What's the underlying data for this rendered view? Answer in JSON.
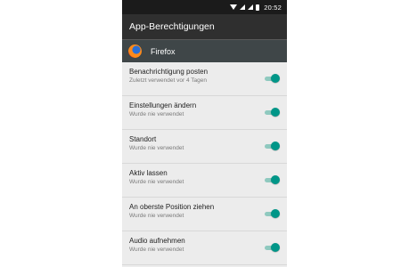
{
  "statusbar": {
    "time": "20:52"
  },
  "appbar": {
    "title": "App-Berechtigungen"
  },
  "app": {
    "name": "Firefox",
    "icon": "firefox-icon"
  },
  "colors": {
    "accent": "#009688",
    "track": "#8fc9bf",
    "appbar": "#2f2f2f",
    "header": "#3f4648"
  },
  "permissions": [
    {
      "title": "Benachrichtigung posten",
      "subtitle": "Zuletzt verwendet vor 4 Tagen",
      "enabled": true
    },
    {
      "title": "Einstellungen ändern",
      "subtitle": "Wurde nie verwendet",
      "enabled": true
    },
    {
      "title": "Standort",
      "subtitle": "Wurde nie verwendet",
      "enabled": true
    },
    {
      "title": "Aktiv lassen",
      "subtitle": "Wurde nie verwendet",
      "enabled": true
    },
    {
      "title": "An oberste Position ziehen",
      "subtitle": "Wurde nie verwendet",
      "enabled": true
    },
    {
      "title": "Audio aufnehmen",
      "subtitle": "Wurde nie verwendet",
      "enabled": true
    }
  ]
}
